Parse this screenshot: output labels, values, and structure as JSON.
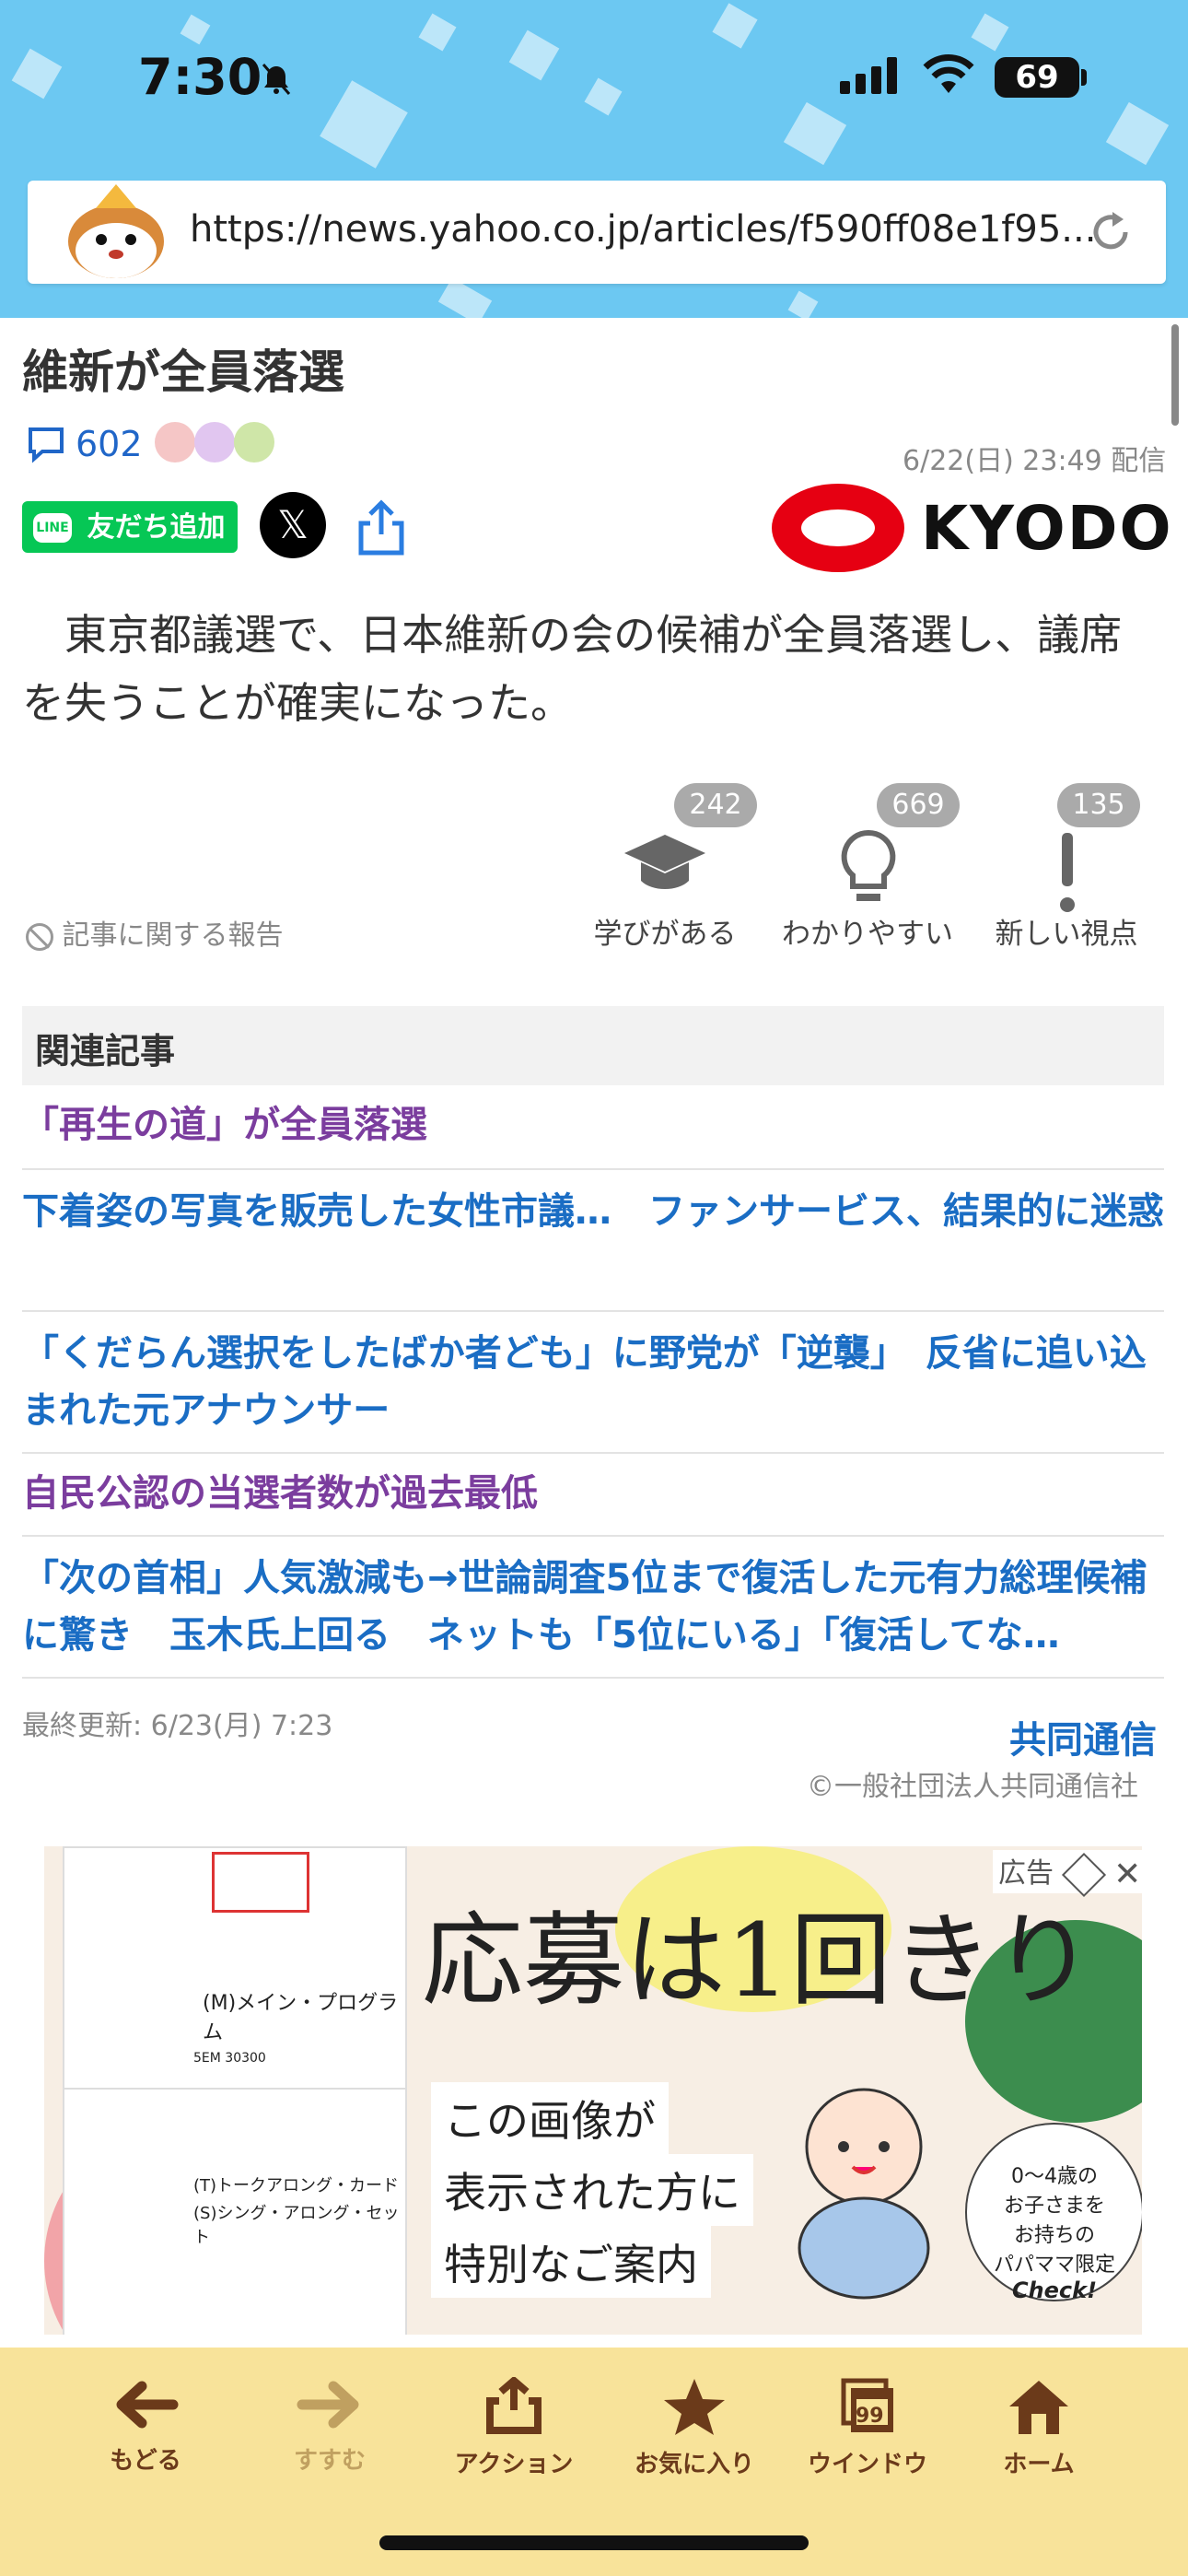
{
  "status_bar": {
    "time": "7:30",
    "battery": "69"
  },
  "browser": {
    "url": "https://news.yahoo.co.jp/articles/f590ff08e1f95..."
  },
  "article": {
    "title": "維新が全員落選",
    "comment_count": "602",
    "date": "6/22(日) 23:49 配信",
    "line_button": "友だち追加",
    "line_logo": "LINE",
    "x_button": "𝕏",
    "source_logo": "KYODO",
    "body": "　東京都議選で、日本維新の会の候補が全員落選し、議席を失うことが確実になった。"
  },
  "reactions": {
    "report": "記事に関する報告",
    "items": [
      {
        "count": "242",
        "label": "学びがある",
        "icon": "graduation-cap-icon"
      },
      {
        "count": "669",
        "label": "わかりやすい",
        "icon": "lightbulb-icon"
      },
      {
        "count": "135",
        "label": "新しい視点",
        "icon": "exclamation-icon"
      }
    ]
  },
  "related": {
    "heading": "関連記事",
    "items": [
      {
        "text": "「再生の道」が全員落選",
        "visited": true
      },
      {
        "text": "下着姿の写真を販売した女性市議…　ファンサービス、結果的に迷惑",
        "visited": false
      },
      {
        "text": "「くだらん選択をしたばか者ども」に野党が「逆襲」　反省に追い込まれた元アナウンサー",
        "visited": false
      },
      {
        "text": "自民公認の当選者数が過去最低",
        "visited": true
      },
      {
        "text": "「次の首相」人気激減も→世論調査5位まで復活した元有力総理候補に驚き　玉木氏上回る　ネットも「5位にいる」「復活してな…",
        "visited": false
      }
    ]
  },
  "footer": {
    "updated": "最終更新: 6/23(月) 7:23",
    "provider": "共同通信",
    "copyright": "©一般社団法人共同通信社"
  },
  "ad": {
    "label": "広告",
    "headline": "応募は1回きり",
    "lines": [
      "この画像が",
      "表示された方に",
      "特別なご案内"
    ],
    "circle_lines": [
      "0〜4歳の",
      "お子さまを",
      "お持ちの",
      "パパママ限定"
    ],
    "check": "Check!",
    "box_label_1": "(M)メイン・プログラム",
    "box_label_2": "(T)トークアロング・カード",
    "box_label_3": "(S)シング・アロング・セット",
    "box_code": "5EM 30300"
  },
  "toolbar": {
    "items": [
      {
        "label": "もどる",
        "icon": "back-arrow-icon",
        "enabled": true
      },
      {
        "label": "すすむ",
        "icon": "forward-arrow-icon",
        "enabled": false
      },
      {
        "label": "アクション",
        "icon": "share-icon",
        "enabled": true
      },
      {
        "label": "お気に入り",
        "icon": "star-icon",
        "enabled": true
      },
      {
        "label": "ウインドウ",
        "icon": "windows-icon",
        "enabled": true,
        "badge": "99"
      },
      {
        "label": "ホーム",
        "icon": "home-icon",
        "enabled": true
      }
    ]
  },
  "colors": {
    "header_bg": "#6cc8f2",
    "link": "#1a6dc4",
    "visited": "#7b3d9e",
    "toolbar_bg": "#f8e39a",
    "line_green": "#06c755",
    "kyodo_red": "#e60012"
  }
}
